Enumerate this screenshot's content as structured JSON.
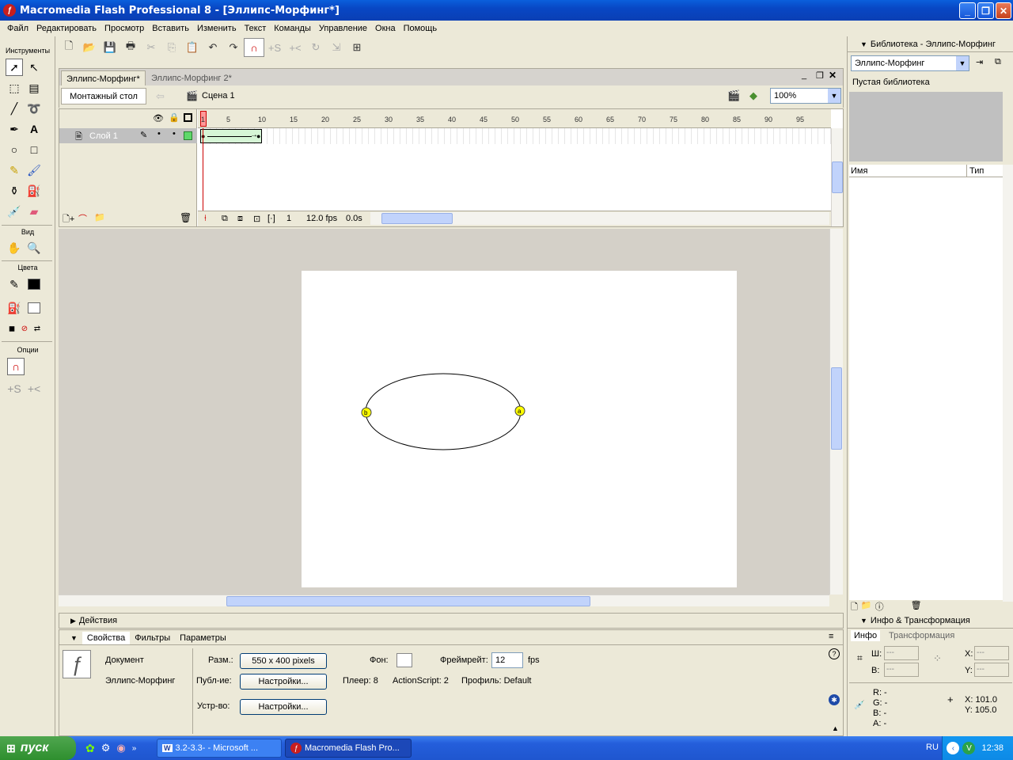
{
  "window": {
    "title": "Macromedia Flash Professional 8 - [Эллипс-Морфинг*]"
  },
  "menu": [
    "Файл",
    "Редактировать",
    "Просмотр",
    "Вставить",
    "Изменить",
    "Текст",
    "Команды",
    "Управление",
    "Окна",
    "Помощь"
  ],
  "tools": {
    "header": "Инструменты",
    "view_header": "Вид",
    "colors_header": "Цвета",
    "options_header": "Опции"
  },
  "document": {
    "tabs": [
      "Эллипс-Морфинг*",
      "Эллипс-Морфинг 2*"
    ],
    "timeline_button": "Монтажный стол",
    "scene": "Сцена 1",
    "zoom": "100%"
  },
  "timeline": {
    "layer_name": "Слой 1",
    "ruler_ticks": [
      "1",
      "5",
      "10",
      "15",
      "20",
      "25",
      "30",
      "35",
      "40",
      "45",
      "50",
      "55",
      "60",
      "65",
      "70",
      "75",
      "80",
      "85",
      "90",
      "95"
    ],
    "current_frame": "1",
    "fps": "12.0 fps",
    "time": "0.0s"
  },
  "stage": {
    "hint_start": "b",
    "hint_end": "a"
  },
  "actions_panel": {
    "title": "Действия"
  },
  "properties": {
    "tabs": [
      "Свойства",
      "Фильтры",
      "Параметры"
    ],
    "type": "Документ",
    "name": "Эллипс-Морфинг",
    "size_label": "Разм.:",
    "size_value": "550 x 400 pixels",
    "bg_label": "Фон:",
    "framerate_label": "Фреймрейт:",
    "framerate_value": "12",
    "fps_unit": "fps",
    "publish_label": "Публ-ие:",
    "settings_btn": "Настройки...",
    "player": "Плеер: 8",
    "actionscript": "ActionScript: 2",
    "profile": "Профиль: Default",
    "device_label": "Устр-во:",
    "device_btn": "Настройки..."
  },
  "library": {
    "title": "Библиотека - Эллипс-Морфинг",
    "selected": "Эллипс-Морфинг",
    "empty_text": "Пустая библиотека",
    "col_name": "Имя",
    "col_type": "Тип"
  },
  "info_panel": {
    "title": "Инфо & Трансформация",
    "tabs": [
      "Инфо",
      "Трансформация"
    ],
    "w_label": "Ш:",
    "h_label": "В:",
    "x_label": "X:",
    "y_label": "Y:",
    "w_val": "---",
    "h_val": "---",
    "x_val": "---",
    "y_val": "---",
    "r": "R: -",
    "g": "G: -",
    "b": "B: -",
    "a": "A: -",
    "mouse_x": "X:  101.0",
    "mouse_y": "Y:  105.0"
  },
  "taskbar": {
    "start": "пуск",
    "tasks": [
      "3.2-3.3- - Microsoft ...",
      "Macromedia Flash Pro..."
    ],
    "lang": "RU",
    "clock": "12:38"
  },
  "colors": {
    "titlebar": "#0a4fd0",
    "stage_bg": "#d4d0c8",
    "hint_fill": "#ffff00",
    "keyframe": "#ff9999"
  }
}
